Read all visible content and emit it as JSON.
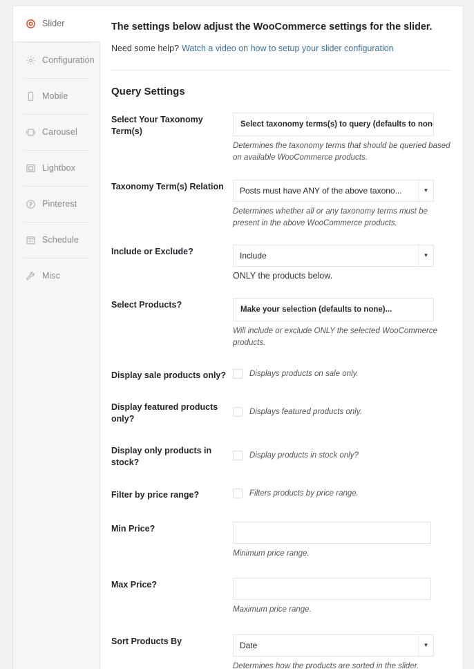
{
  "colors": {
    "accent": "#d94f2b",
    "link": "#3c6f9c",
    "panel_bg": "#ffffff",
    "sidebar_bg": "#f6f6f6",
    "page_bg": "#f1f1f1",
    "border": "#e5e5e5",
    "label_text": "#23282d",
    "desc_text": "#555555"
  },
  "sidebar": {
    "items": [
      {
        "label": "Slider",
        "icon": "lifebuoy-icon",
        "active": true
      },
      {
        "label": "Configuration",
        "icon": "gear-icon",
        "active": false
      },
      {
        "label": "Mobile",
        "icon": "mobile-phone-icon",
        "active": false
      },
      {
        "label": "Carousel",
        "icon": "carousel-icon",
        "active": false
      },
      {
        "label": "Lightbox",
        "icon": "lightbox-icon",
        "active": false
      },
      {
        "label": "Pinterest",
        "icon": "pinterest-icon",
        "active": false
      },
      {
        "label": "Schedule",
        "icon": "calendar-icon",
        "active": false
      },
      {
        "label": "Misc",
        "icon": "wrench-icon",
        "active": false
      }
    ]
  },
  "intro": {
    "title": "The settings below adjust the WooCommerce settings for the slider.",
    "help_prefix": "Need some help?",
    "help_link": "Watch a video on how to setup your slider configuration"
  },
  "query_settings": {
    "heading": "Query Settings",
    "fields": {
      "taxonomy_terms": {
        "label": "Select Your Taxonomy Term(s)",
        "placeholder": "Select taxonomy terms(s) to query (defaults to none)...",
        "value": "",
        "description": "Determines the taxonomy terms that should be queried based on available WooCommerce products."
      },
      "taxonomy_relation": {
        "label": "Taxonomy Term(s) Relation",
        "value": "Posts must have ANY of the above taxono...",
        "description": "Determines whether all or any taxonomy terms must be present in the above WooCommerce products."
      },
      "include_exclude": {
        "label": "Include or Exclude?",
        "value": "Include",
        "description": "ONLY the products below."
      },
      "select_products": {
        "label": "Select Products?",
        "placeholder": "Make your selection (defaults to none)...",
        "value": "",
        "description": "Will include or exclude ONLY the selected WooCommerce products."
      },
      "sale_only": {
        "label": "Display sale products only?",
        "checked": false,
        "description": "Displays products on sale only."
      },
      "featured_only": {
        "label": "Display featured products only?",
        "checked": false,
        "description": "Displays featured products only."
      },
      "in_stock_only": {
        "label": "Display only products in stock?",
        "checked": false,
        "description": "Display products in stock only?"
      },
      "filter_price": {
        "label": "Filter by price range?",
        "checked": false,
        "description": "Filters products by price range."
      },
      "min_price": {
        "label": "Min Price?",
        "value": "",
        "description": "Minimum price range."
      },
      "max_price": {
        "label": "Max Price?",
        "value": "",
        "description": "Maximum price range."
      },
      "sort_by": {
        "label": "Sort Products By",
        "value": "Date",
        "description": "Determines how the products are sorted in the slider."
      }
    }
  },
  "icons": {
    "dropdown_arrow": "▼"
  }
}
